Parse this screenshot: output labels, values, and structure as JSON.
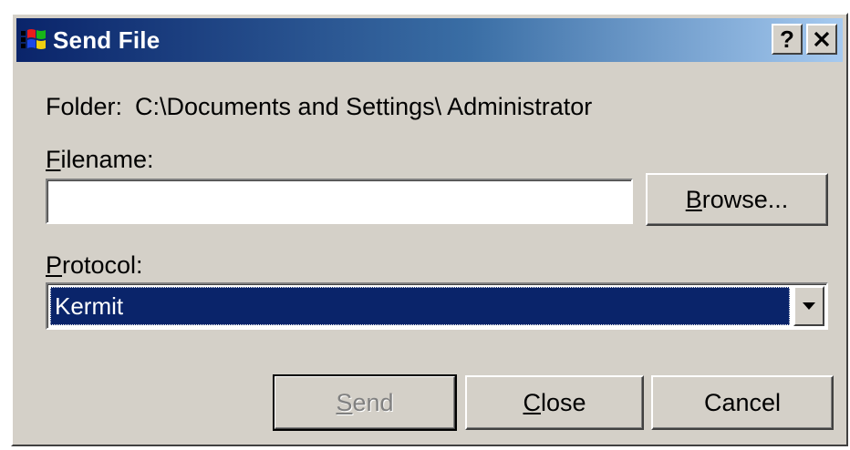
{
  "window": {
    "title": "Send File",
    "help_button": "?",
    "close_button": "✕"
  },
  "folder": {
    "label": "Folder:",
    "path": "C:\\Documents and Settings\\ Administrator"
  },
  "filename": {
    "label_first": "F",
    "label_rest": "ilename:",
    "value": "",
    "placeholder": ""
  },
  "browse_button": {
    "mnemonic": "B",
    "rest": "rowse..."
  },
  "protocol": {
    "label_first": "P",
    "label_rest": "rotocol:",
    "selected": "Kermit"
  },
  "buttons": {
    "send_mnemonic": "S",
    "send_rest": "end",
    "close_mnemonic": "C",
    "close_rest": "lose",
    "cancel": "Cancel"
  },
  "icons": {
    "app": "windows-flag-icon",
    "dropdown": "triangle-down-icon"
  },
  "colors": {
    "title_start": "#0a246a",
    "title_end": "#a6caf0",
    "selection": "#0a246a",
    "face": "#d4d0c8"
  }
}
